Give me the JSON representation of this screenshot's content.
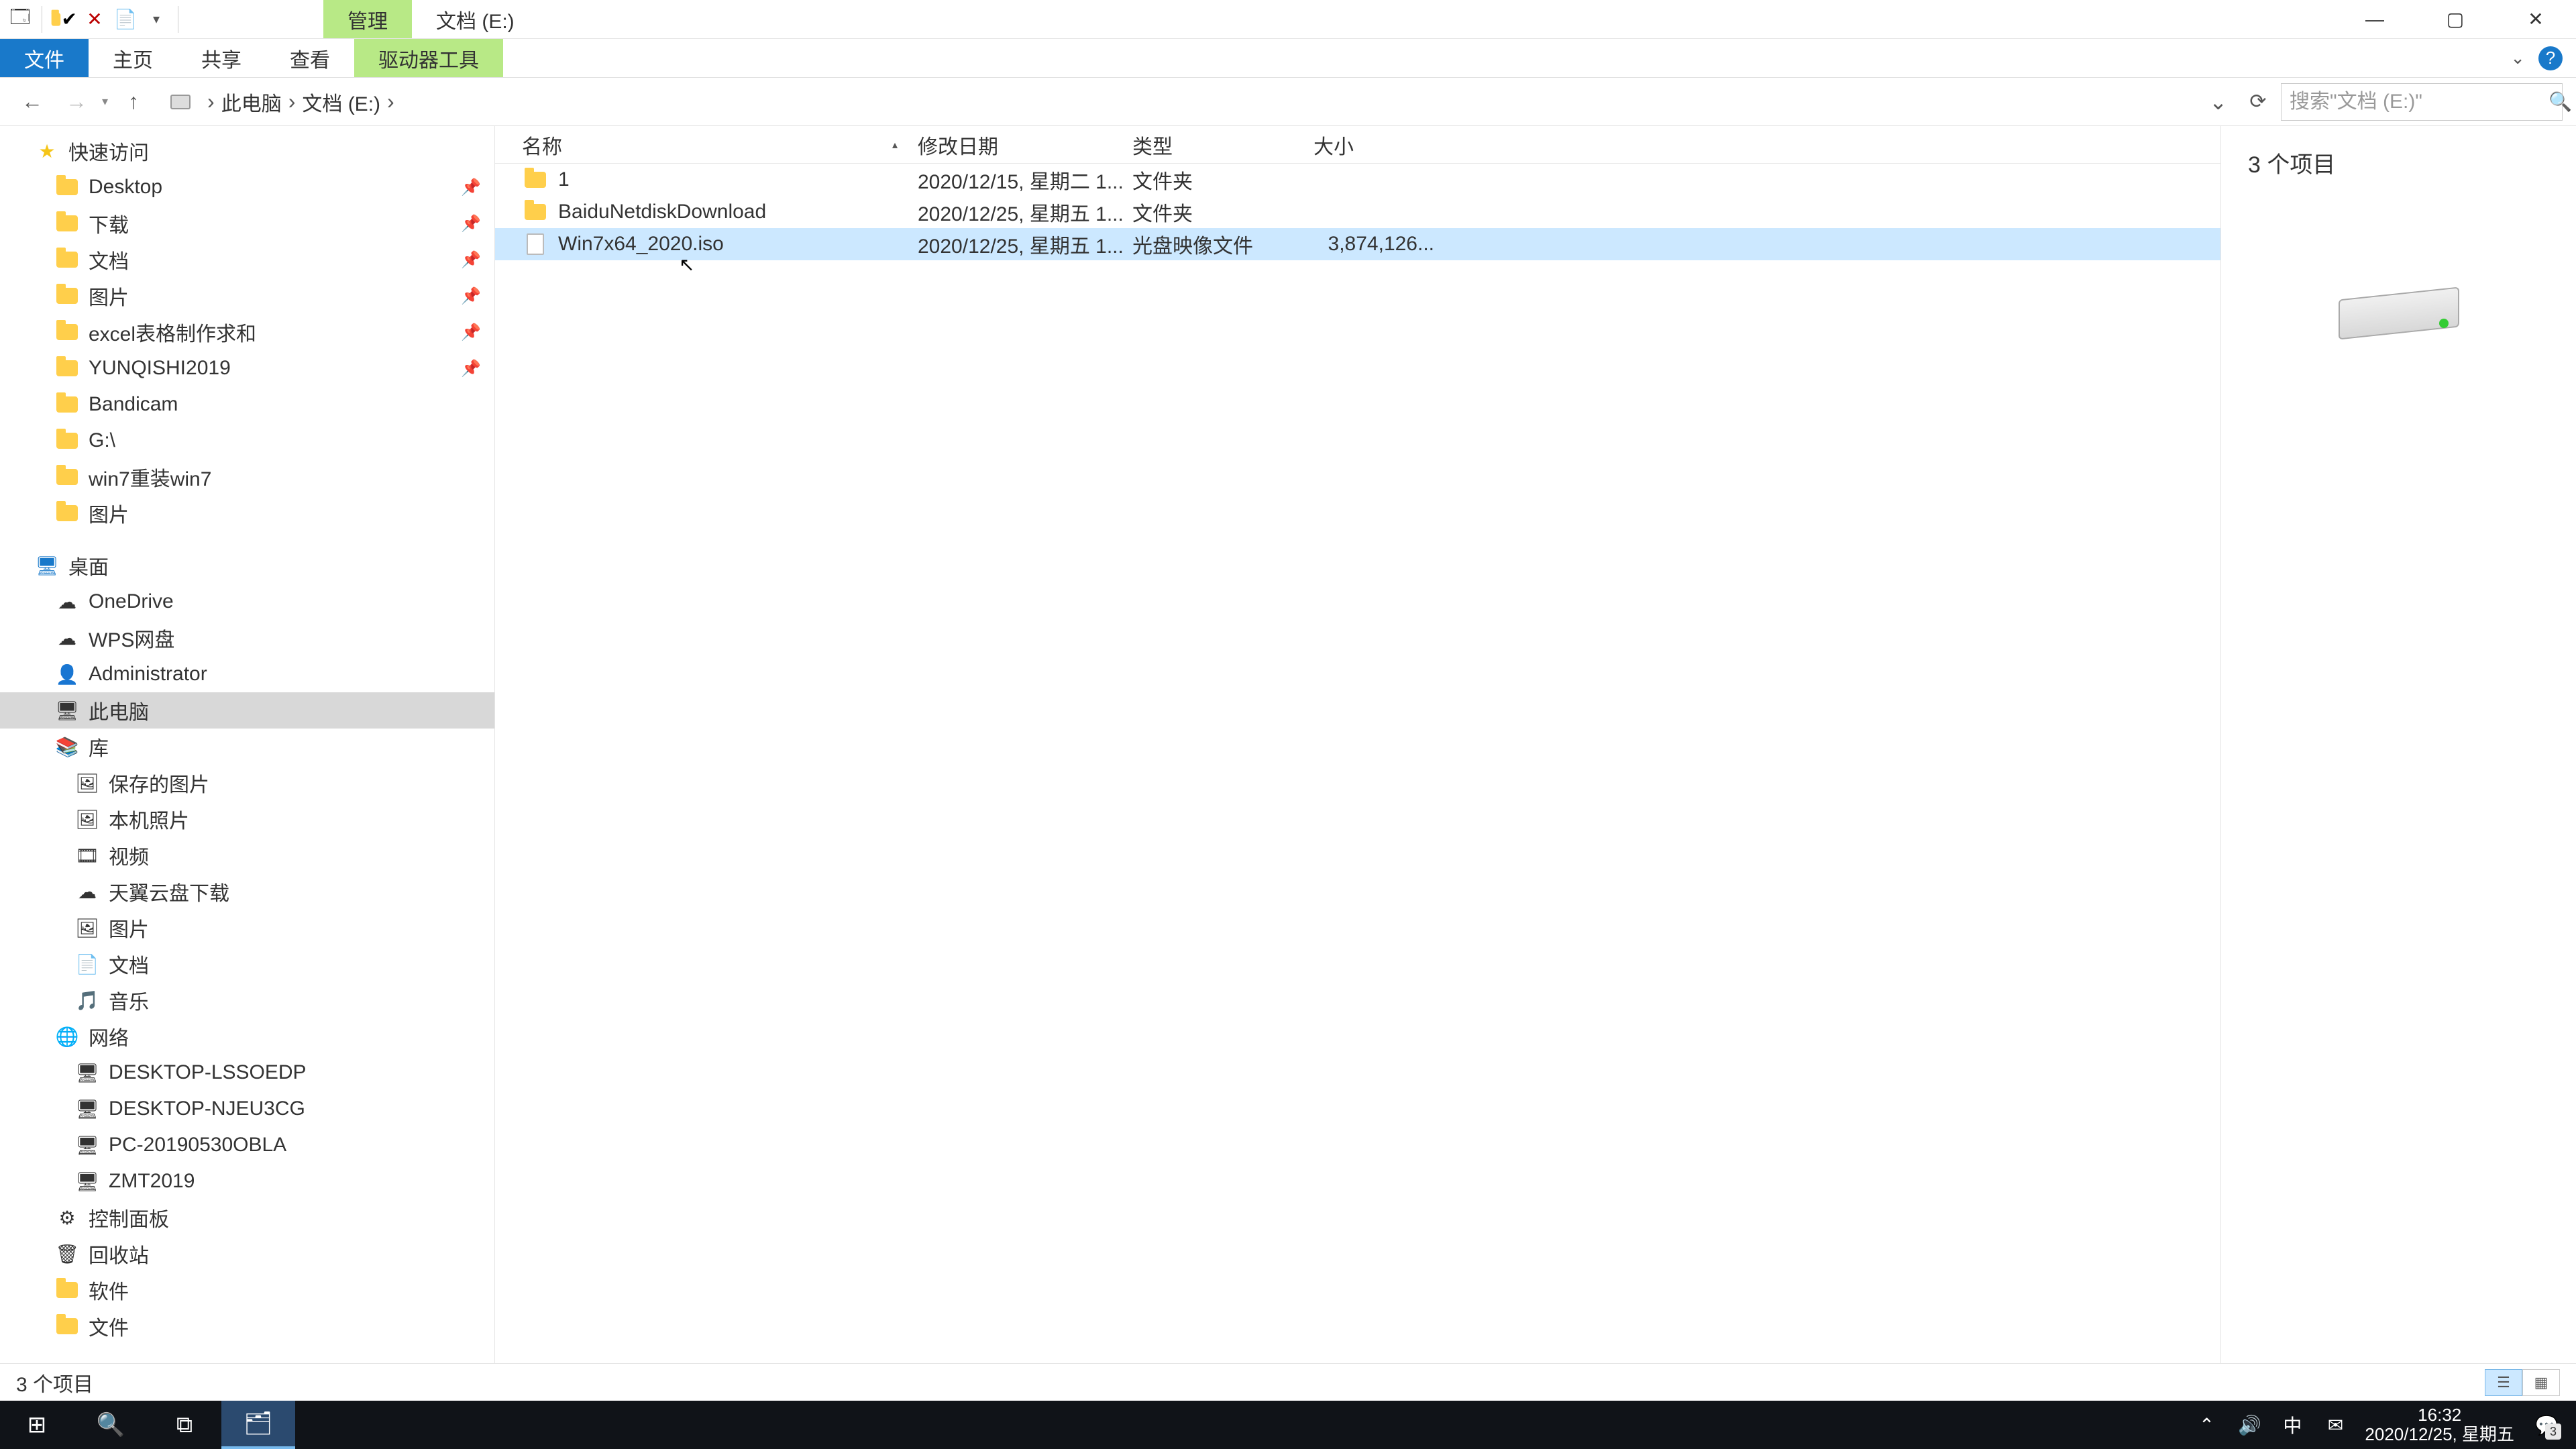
{
  "titlebar": {
    "context_tab": "管理",
    "title": "文档 (E:)"
  },
  "ribbon": {
    "file": "文件",
    "tabs": [
      "主页",
      "共享",
      "查看",
      "驱动器工具"
    ]
  },
  "address": {
    "segments": [
      "此电脑",
      "文档 (E:)"
    ],
    "search_placeholder": "搜索\"文档 (E:)\""
  },
  "columns": {
    "name": "名称",
    "date": "修改日期",
    "type": "类型",
    "size": "大小"
  },
  "files": [
    {
      "name": "1",
      "date": "2020/12/15, 星期二 1...",
      "type": "文件夹",
      "size": "",
      "icon": "folder",
      "selected": false
    },
    {
      "name": "BaiduNetdiskDownload",
      "date": "2020/12/25, 星期五 1...",
      "type": "文件夹",
      "size": "",
      "icon": "folder",
      "selected": false
    },
    {
      "name": "Win7x64_2020.iso",
      "date": "2020/12/25, 星期五 1...",
      "type": "光盘映像文件",
      "size": "3,874,126...",
      "icon": "file",
      "selected": true
    }
  ],
  "sidebar": {
    "quick_access": "快速访问",
    "quick_items": [
      {
        "label": "Desktop",
        "pinned": true,
        "icon": "folder-blue"
      },
      {
        "label": "下载",
        "pinned": true,
        "icon": "folder-blue"
      },
      {
        "label": "文档",
        "pinned": true,
        "icon": "folder"
      },
      {
        "label": "图片",
        "pinned": true,
        "icon": "folder"
      },
      {
        "label": "excel表格制作求和",
        "pinned": true,
        "icon": "folder"
      },
      {
        "label": "YUNQISHI2019",
        "pinned": true,
        "icon": "folder"
      },
      {
        "label": "Bandicam",
        "pinned": false,
        "icon": "folder"
      },
      {
        "label": "G:\\",
        "pinned": false,
        "icon": "drive"
      },
      {
        "label": "win7重装win7",
        "pinned": false,
        "icon": "folder"
      },
      {
        "label": "图片",
        "pinned": false,
        "icon": "folder"
      }
    ],
    "desktop": "桌面",
    "desktop_items": [
      {
        "label": "OneDrive",
        "icon": "cloud"
      },
      {
        "label": "WPS网盘",
        "icon": "cloud"
      },
      {
        "label": "Administrator",
        "icon": "user"
      },
      {
        "label": "此电脑",
        "icon": "pc",
        "selected": true
      },
      {
        "label": "库",
        "icon": "library"
      },
      {
        "label": "保存的图片",
        "icon": "pic",
        "indent": 2
      },
      {
        "label": "本机照片",
        "icon": "pic",
        "indent": 2
      },
      {
        "label": "视频",
        "icon": "video",
        "indent": 2
      },
      {
        "label": "天翼云盘下载",
        "icon": "cloud",
        "indent": 2
      },
      {
        "label": "图片",
        "icon": "pic",
        "indent": 2
      },
      {
        "label": "文档",
        "icon": "doc",
        "indent": 2
      },
      {
        "label": "音乐",
        "icon": "music",
        "indent": 2
      },
      {
        "label": "网络",
        "icon": "net"
      },
      {
        "label": "DESKTOP-LSSOEDP",
        "icon": "pc-net",
        "indent": 2
      },
      {
        "label": "DESKTOP-NJEU3CG",
        "icon": "pc-net",
        "indent": 2
      },
      {
        "label": "PC-20190530OBLA",
        "icon": "pc-net",
        "indent": 2
      },
      {
        "label": "ZMT2019",
        "icon": "pc-net",
        "indent": 2
      },
      {
        "label": "控制面板",
        "icon": "control"
      },
      {
        "label": "回收站",
        "icon": "recycle"
      },
      {
        "label": "软件",
        "icon": "folder"
      },
      {
        "label": "文件",
        "icon": "folder"
      }
    ]
  },
  "preview": {
    "title": "3 个项目"
  },
  "status": {
    "text": "3 个项目"
  },
  "taskbar": {
    "time": "16:32",
    "date": "2020/12/25, 星期五",
    "ime": "中",
    "notif_count": "3"
  }
}
